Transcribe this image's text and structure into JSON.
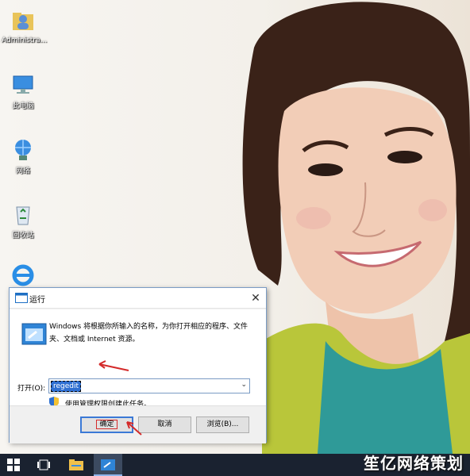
{
  "desktop": {
    "icons": [
      {
        "label": "Administra...",
        "icon": "user-folder-icon"
      },
      {
        "label": "此电脑",
        "icon": "computer-icon"
      },
      {
        "label": "网络",
        "icon": "network-icon"
      },
      {
        "label": "回收站",
        "icon": "recycle-bin-icon"
      },
      {
        "label": "",
        "icon": "internet-explorer-icon"
      }
    ]
  },
  "run_dialog": {
    "title": "运行",
    "close_glyph": "✕",
    "description": "Windows 将根据你所输入的名称，为你打开相应的程序、文件夹、文档或 Internet 资源。",
    "open_label": "打开(O):",
    "open_value": "regedit",
    "admin_note": "使用管理权限创建此任务。",
    "ok_label": "确定",
    "cancel_label": "取消",
    "browse_label": "浏览(B)..."
  },
  "taskbar": {
    "items": [
      "start-button",
      "task-view-button",
      "file-explorer-button",
      "run-button"
    ]
  },
  "watermark": "笙亿网络策划"
}
